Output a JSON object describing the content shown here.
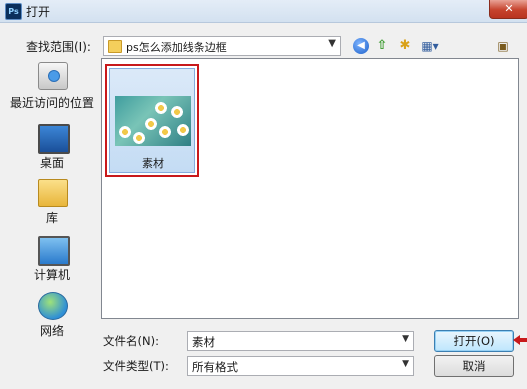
{
  "window": {
    "title": "打开",
    "app_icon": "photoshop-icon",
    "close_label": "✕"
  },
  "toolbar": {
    "look_in_label": "查找范围(I):",
    "look_in_value": "ps怎么添加线条边框",
    "back_icon": "back-icon",
    "up_icon": "up-folder-icon",
    "new_folder_icon": "new-folder-icon",
    "view_menu_icon": "view-menu-icon",
    "desktop_icon": "desktop-shortcut-icon"
  },
  "places": [
    {
      "label": "最近访问的位置",
      "icon": "recent-places-icon"
    },
    {
      "label": "桌面",
      "icon": "desktop-icon"
    },
    {
      "label": "库",
      "icon": "library-icon"
    },
    {
      "label": "计算机",
      "icon": "computer-icon"
    },
    {
      "label": "网络",
      "icon": "network-icon"
    }
  ],
  "files": [
    {
      "name": "素材",
      "selected": true,
      "highlight_color": "#c8191b"
    }
  ],
  "form": {
    "filename_label": "文件名(N):",
    "filename_value": "素材",
    "filetype_label": "文件类型(T):",
    "filetype_value": "所有格式",
    "open_label": "打开(O)",
    "cancel_label": "取消"
  },
  "colors": {
    "selection_outline": "#c8191b",
    "pointer_arrow": "#c8191b"
  }
}
